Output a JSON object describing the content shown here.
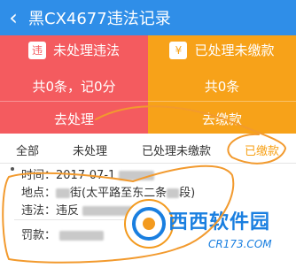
{
  "header": {
    "back_icon": "‹",
    "title": "黑CX4677违法记录"
  },
  "cards": [
    {
      "badge": "违",
      "label": "未处理违法",
      "stat": "共0条，记0分",
      "action": "去处理",
      "color": "#f45b5f"
    },
    {
      "badge": "¥",
      "label": "已处理未缴款",
      "stat": "共0条",
      "action": "去缴款",
      "color": "#f7a219"
    }
  ],
  "tabs": [
    {
      "label": "全部"
    },
    {
      "label": "未处理"
    },
    {
      "label": "已处理未缴款"
    },
    {
      "label": "已缴款",
      "active": true
    }
  ],
  "record": {
    "time_label": "时间：",
    "time_value": "2017-07-1",
    "location_label": "地点：",
    "location_value": "街(太平路至东二条",
    "location_suffix": "段)",
    "violation_label": "违法：",
    "violation_value": "违反",
    "fine_label": "罚款："
  },
  "watermark": {
    "brand": "西西软件园",
    "url": "CR173.COM"
  }
}
